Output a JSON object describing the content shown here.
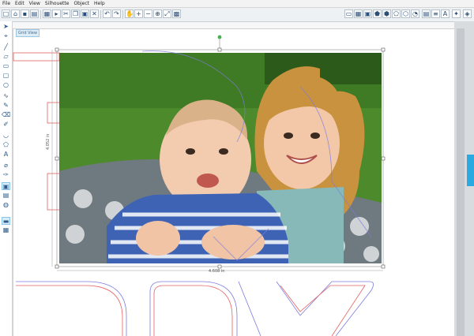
{
  "menubar": {
    "items": [
      "File",
      "Edit",
      "View",
      "Silhouette",
      "Object",
      "Help"
    ]
  },
  "toolbar": {
    "left_icons": [
      "new-icon",
      "open-icon",
      "save-icon",
      "template-icon",
      "library-icon",
      "send-icon",
      "cut-icon",
      "copy-icon",
      "paste-icon",
      "delete-icon",
      "undo-icon",
      "redo-icon",
      "pan-icon",
      "zoom-in-icon",
      "zoom-out-icon",
      "zoom-box-icon",
      "fit-icon",
      "page-fit-icon"
    ],
    "right_icons": [
      "page-setup-icon",
      "grid-icon",
      "register-icon",
      "draw-icon",
      "fill-icon",
      "line-icon",
      "shadow-icon",
      "align-icon",
      "replicate-icon",
      "text-style-icon",
      "transform-icon",
      "offset-icon"
    ]
  },
  "grid_label": "Grid View",
  "measurements": {
    "height": "4.052 in",
    "width": "4.608 in"
  },
  "left_tools": [
    "select-icon",
    "node-edit-icon",
    "line-icon",
    "polygon-icon",
    "rectangle-icon",
    "rounded-rect-icon",
    "ellipse-icon",
    "curve-icon",
    "knife-icon",
    "eraser-icon",
    "freehand-icon",
    "arc-icon",
    "polygon-tool-icon",
    "text-icon",
    "trace-icon",
    "eyedropper-icon",
    "layers-icon",
    "view-icon",
    "store-icon",
    "library-panel-icon",
    "design-view-icon"
  ],
  "colors": {
    "accent": "#29abe2",
    "outline_blue": "#7d7be0",
    "outline_red": "#e46060"
  }
}
